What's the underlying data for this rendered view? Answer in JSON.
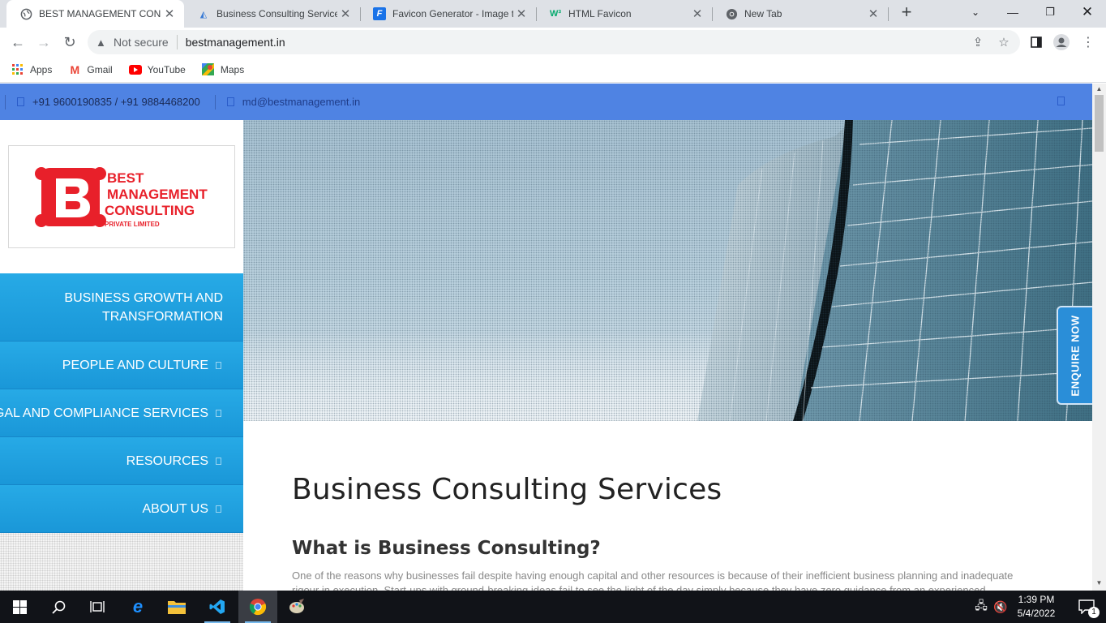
{
  "browser": {
    "tabs": [
      {
        "title": "BEST MANAGEMENT CONSULTING",
        "active": true,
        "icon": "globe-icon"
      },
      {
        "title": "Business Consulting Services",
        "active": false,
        "icon": "site-logo-icon"
      },
      {
        "title": "Favicon Generator - Image to Favicon",
        "active": false,
        "icon": "favicon-f-icon"
      },
      {
        "title": "HTML Favicon",
        "active": false,
        "icon": "w3schools-icon"
      },
      {
        "title": "New Tab",
        "active": false,
        "icon": "chrome-icon"
      }
    ],
    "security_label": "Not secure",
    "url": "bestmanagement.in",
    "bookmarks": [
      {
        "label": "Apps",
        "icon": "apps-grid-icon"
      },
      {
        "label": "Gmail",
        "icon": "gmail-icon"
      },
      {
        "label": "YouTube",
        "icon": "youtube-icon"
      },
      {
        "label": "Maps",
        "icon": "maps-icon"
      }
    ]
  },
  "site": {
    "phone": "+91 9600190835 / +91 9884468200",
    "email": "md@bestmanagement.in",
    "logo": {
      "letter": "B",
      "line1": "BEST",
      "line2": "MANAGEMENT",
      "line3": "CONSULTING",
      "line4": "PRIVATE LIMITED"
    },
    "menu": [
      {
        "label": "BUSINESS GROWTH AND TRANSFORMATION"
      },
      {
        "label": "PEOPLE AND CULTURE"
      },
      {
        "label": "LEGAL AND COMPLIANCE SERVICES"
      },
      {
        "label": "RESOURCES"
      },
      {
        "label": "ABOUT US"
      }
    ],
    "heading": "Business Consulting Services",
    "subheading": "What is Business Consulting?",
    "paragraph": "One of the reasons why businesses fail despite having enough capital and other resources is because of their inefficient business planning and inadequate rigour in execution. Start-ups with ground-breaking ideas fail to see the light of the day simply because they have zero guidance from an experienced",
    "enquire_label": "ENQUIRE NOW",
    "colors": {
      "topbar": "#4f83e3",
      "menu": "#1a97d8",
      "logo_red": "#e8202a"
    }
  },
  "taskbar": {
    "time": "1:39 PM",
    "date": "5/4/2022",
    "notification_count": "1"
  }
}
